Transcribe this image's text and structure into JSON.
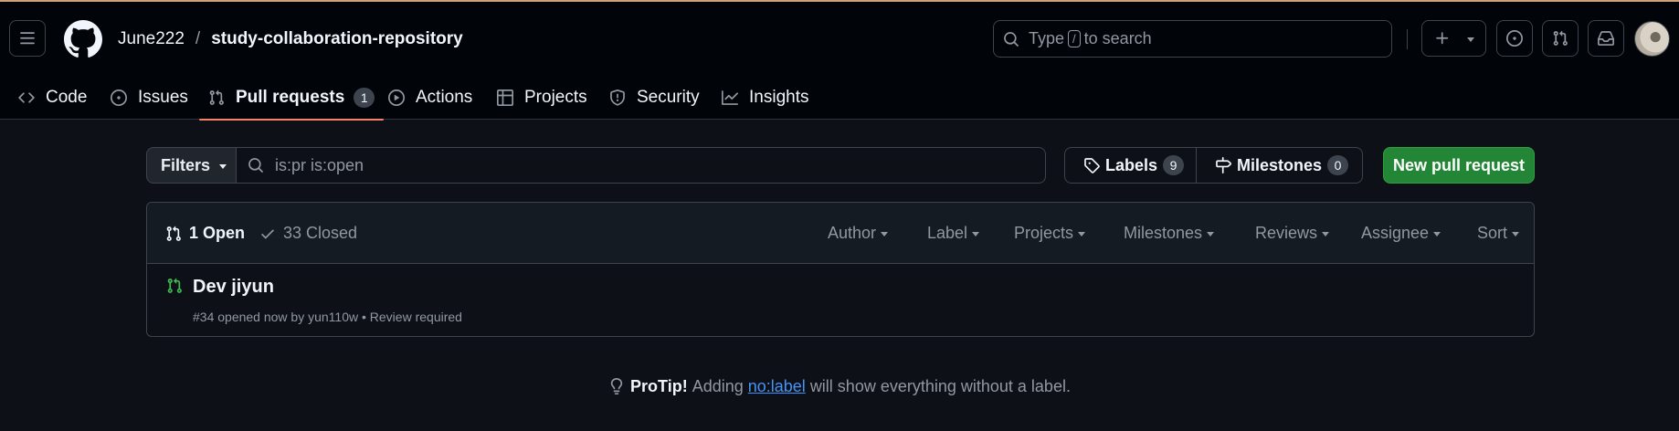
{
  "header": {
    "owner": "June222",
    "separator": "/",
    "repo": "study-collaboration-repository",
    "search": {
      "prefix": "Type",
      "key": "/",
      "suffix": "to search"
    }
  },
  "tabs": [
    {
      "label": "Code",
      "icon": "code-icon"
    },
    {
      "label": "Issues",
      "icon": "issue-opened-icon"
    },
    {
      "label": "Pull requests",
      "icon": "git-pull-request-icon",
      "count": "1",
      "active": true
    },
    {
      "label": "Actions",
      "icon": "play-icon"
    },
    {
      "label": "Projects",
      "icon": "table-icon"
    },
    {
      "label": "Security",
      "icon": "shield-icon"
    },
    {
      "label": "Insights",
      "icon": "graph-icon"
    }
  ],
  "filterbar": {
    "filters_label": "Filters",
    "query": "is:pr is:open",
    "labels_label": "Labels",
    "labels_count": "9",
    "milestones_label": "Milestones",
    "milestones_count": "0",
    "new_pr_label": "New pull request"
  },
  "list": {
    "open_label": "1 Open",
    "closed_label": "33 Closed",
    "sorters": [
      "Author",
      "Label",
      "Projects",
      "Milestones",
      "Reviews",
      "Assignee",
      "Sort"
    ],
    "items": [
      {
        "title": "Dev jiyun",
        "meta": "#34 opened now by yun110w • Review required"
      }
    ]
  },
  "protip": {
    "lead": "ProTip!",
    "before": "Adding",
    "link": "no:label",
    "after": "will show everything without a label."
  },
  "colors": {
    "background": "#0d1117",
    "header_bg": "#010409",
    "accent_underline": "#f78166",
    "primary_button": "#238636",
    "open_pr_icon": "#3fb950",
    "link": "#4493f8"
  }
}
